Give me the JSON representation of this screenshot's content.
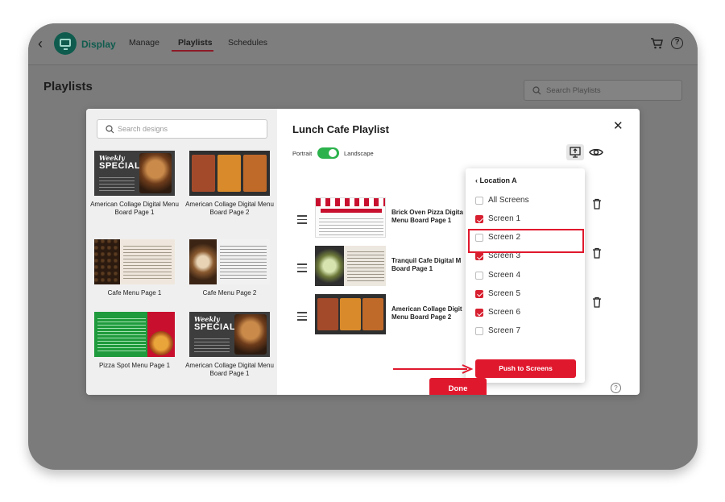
{
  "topbar": {
    "brand": "Display",
    "nav": [
      "Manage",
      "Playlists",
      "Schedules"
    ],
    "active_nav": "Playlists"
  },
  "page": {
    "title": "Playlists",
    "search_placeholder": "Search Playlists"
  },
  "modal": {
    "title": "Lunch Cafe Playlist",
    "design_search_placeholder": "Search designs",
    "orientation": {
      "portrait": "Portrait",
      "landscape": "Landscape",
      "selected": "Landscape"
    },
    "designs": [
      {
        "label": "American Collage Digital Menu Board Page 1"
      },
      {
        "label": "American Collage Digital Menu Board Page 2"
      },
      {
        "label": "Cafe Menu Page 1"
      },
      {
        "label": "Cafe Menu Page 2"
      },
      {
        "label": "Pizza Spot Menu Page 1"
      },
      {
        "label": "American Collage Digital Menu Board Page 1"
      }
    ],
    "thumb_text": {
      "weekly": "Weekly",
      "specials": "SPECIALS"
    },
    "playlist_items": [
      {
        "title": "Brick Oven Pizza Digita Menu Board Page 1"
      },
      {
        "title": "Tranquil Cafe Digital M Board Page 1"
      },
      {
        "title": "American Collage Digit Menu Board Page 2"
      }
    ],
    "done_label": "Done"
  },
  "screen_dropdown": {
    "location": "Location A",
    "all_label": "All Screens",
    "screens": [
      {
        "label": "Screen 1",
        "checked": true
      },
      {
        "label": "Screen 2",
        "checked": false
      },
      {
        "label": "Screen 3",
        "checked": true
      },
      {
        "label": "Screen 4",
        "checked": false
      },
      {
        "label": "Screen 5",
        "checked": true
      },
      {
        "label": "Screen 6",
        "checked": true
      },
      {
        "label": "Screen 7",
        "checked": false
      }
    ],
    "push_label": "Push to Screens"
  },
  "colors": {
    "accent": "#e0182d",
    "toggle_on": "#2bb24c",
    "brand": "#0f5c4e"
  }
}
